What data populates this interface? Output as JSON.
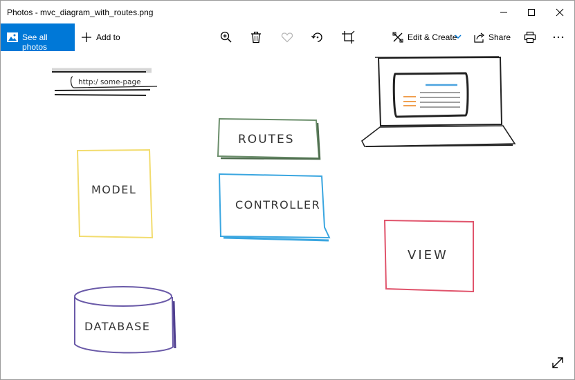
{
  "window": {
    "title": "Photos - mvc_diagram_with_routes.png",
    "controls": [
      "minimize",
      "maximize",
      "close"
    ]
  },
  "toolbar": {
    "see_all_label": "See all photos",
    "add_to_label": "Add to",
    "icons": [
      "zoom-in-icon",
      "delete-icon",
      "favorite-heart-icon",
      "rotate-icon",
      "crop-icon"
    ],
    "edit_create_label": "Edit & Create",
    "share_label": "Share",
    "right_icons": [
      "print-icon",
      "more-icon"
    ],
    "accent": "#0078d7"
  },
  "diagram": {
    "url_text": "http:/ some-page",
    "routes": "ROUTES",
    "model": "MODEL",
    "controller": "CONTROLLER",
    "view": "VIEW",
    "database": "DATABASE",
    "colors": {
      "routes": "#6b8e6b",
      "model": "#f2dc6e",
      "controller": "#3aa6e0",
      "view": "#e0536b",
      "database": "#6a5aa8",
      "screen_orange": "#f0a050",
      "screen_blue": "#4aa3df"
    }
  },
  "footer": {
    "expand_icon": "expand-icon"
  }
}
